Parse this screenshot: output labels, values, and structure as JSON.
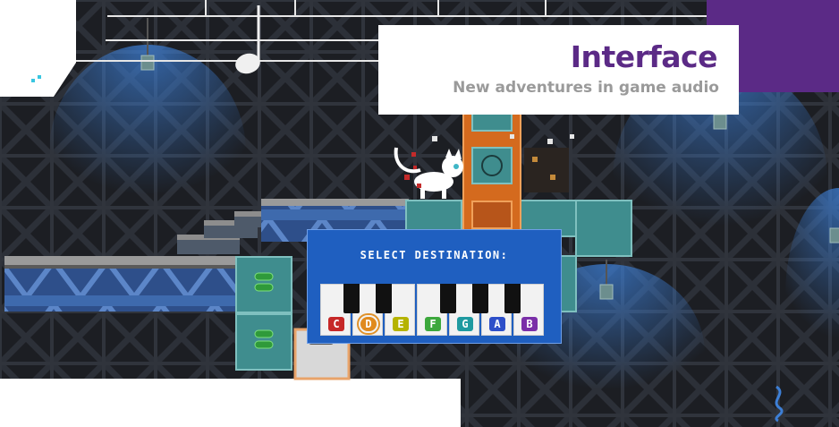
{
  "header": {
    "title": "Interface",
    "subtitle": "New adventures in game audio"
  },
  "dialog": {
    "prompt": "SELECT DESTINATION:",
    "notes": [
      {
        "label": "C",
        "color": "#c62828",
        "selected": false
      },
      {
        "label": "D",
        "color": "#e08a1e",
        "selected": true
      },
      {
        "label": "E",
        "color": "#b5b300",
        "selected": false
      },
      {
        "label": "F",
        "color": "#3ca83c",
        "selected": false
      },
      {
        "label": "G",
        "color": "#1f9aa0",
        "selected": false
      },
      {
        "label": "A",
        "color": "#2d4fc9",
        "selected": false
      },
      {
        "label": "B",
        "color": "#7a2fa8",
        "selected": false
      }
    ]
  },
  "colors": {
    "brand_purple": "#5b2a86",
    "panel_blue": "#1f5fc0",
    "background_dark": "#1b1d22",
    "orange_block": "#d46a1e",
    "teal_block": "#3f8d8e"
  }
}
